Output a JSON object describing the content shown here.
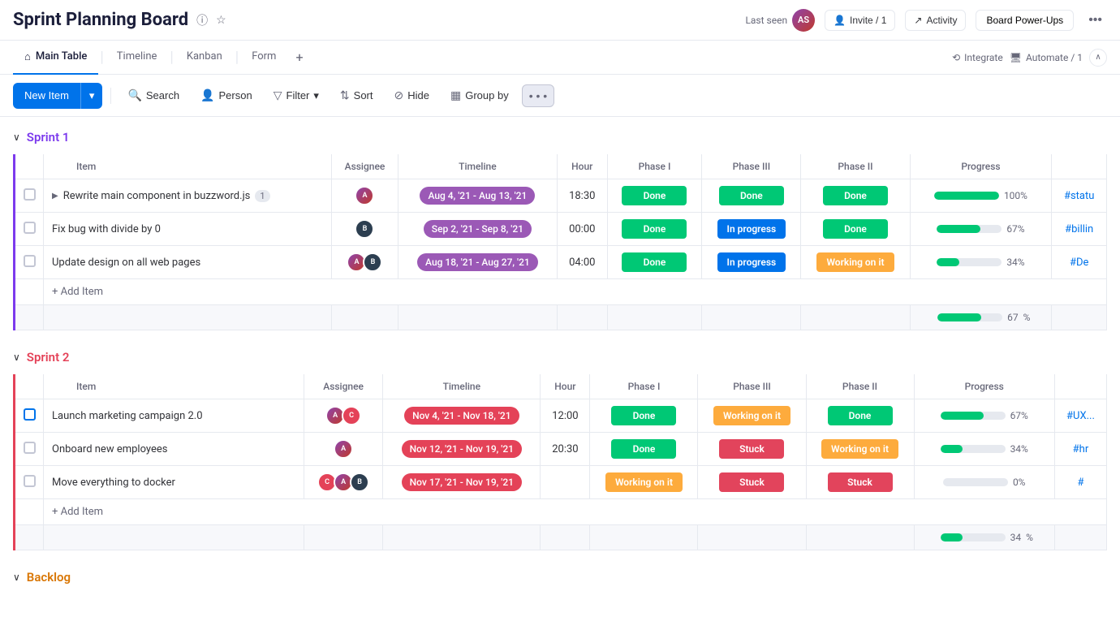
{
  "header": {
    "title": "Sprint Planning Board",
    "info_icon": "ⓘ",
    "star_icon": "☆",
    "last_seen_label": "Last seen",
    "invite_label": "Invite / 1",
    "activity_label": "Activity",
    "power_ups_label": "Board Power-Ups",
    "more_icon": "•••"
  },
  "nav": {
    "tabs": [
      {
        "label": "Main Table",
        "icon": "⌂",
        "active": true
      },
      {
        "label": "Timeline",
        "active": false
      },
      {
        "label": "Kanban",
        "active": false
      },
      {
        "label": "Form",
        "active": false
      }
    ],
    "integrate_label": "Integrate",
    "automate_label": "Automate / 1"
  },
  "toolbar": {
    "new_item_label": "New Item",
    "search_label": "Search",
    "person_label": "Person",
    "filter_label": "Filter",
    "sort_label": "Sort",
    "hide_label": "Hide",
    "group_by_label": "Group by"
  },
  "sprint1": {
    "title": "Sprint 1",
    "color": "purple",
    "columns": [
      "Item",
      "Assignee",
      "Timeline",
      "Hour",
      "Phase I",
      "Phase III",
      "Phase II",
      "Progress"
    ],
    "rows": [
      {
        "name": "Rewrite main component in buzzword.js",
        "badge": "1",
        "assignees": [
          "#8e44ad"
        ],
        "timeline": "Aug 4, '21 - Aug 13, '21",
        "timeline_color": "purple",
        "hour": "18:30",
        "phase1": "Done",
        "phase3": "Done",
        "phase2": "Done",
        "progress": 100,
        "tag": "#statu",
        "has_expand": true
      },
      {
        "name": "Fix bug with divide by 0",
        "badge": "",
        "assignees": [
          "#2c3e50"
        ],
        "timeline": "Sep 2, '21 - Sep 8, '21",
        "timeline_color": "purple",
        "hour": "00:00",
        "phase1": "Done",
        "phase3": "In progress",
        "phase2": "Done",
        "progress": 67,
        "tag": "#billin",
        "has_expand": false
      },
      {
        "name": "Update design on all web pages",
        "badge": "",
        "assignees": [
          "#8e44ad",
          "#2c3e50"
        ],
        "timeline": "Aug 18, '21 - Aug 27, '21",
        "timeline_color": "purple",
        "hour": "04:00",
        "phase1": "Done",
        "phase3": "In progress",
        "phase2": "Working on it",
        "progress": 34,
        "tag": "#De",
        "has_expand": false
      }
    ],
    "add_item_label": "+ Add Item",
    "summary_progress": 67
  },
  "sprint2": {
    "title": "Sprint 2",
    "color": "coral",
    "columns": [
      "Item",
      "Assignee",
      "Timeline",
      "Hour",
      "Phase I",
      "Phase III",
      "Phase II",
      "Progress"
    ],
    "rows": [
      {
        "name": "Launch marketing campaign 2.0",
        "badge": "",
        "assignees": [
          "#8e44ad",
          "#e44258"
        ],
        "timeline": "Nov 4, '21 - Nov 18, '21",
        "timeline_color": "coral",
        "hour": "12:00",
        "phase1": "Done",
        "phase3": "Working on it",
        "phase2": "Done",
        "progress": 67,
        "tag": "#UX...",
        "has_expand": false,
        "checked_blue": true
      },
      {
        "name": "Onboard new employees",
        "badge": "",
        "assignees": [
          "#8e44ad"
        ],
        "timeline": "Nov 12, '21 - Nov 19, '21",
        "timeline_color": "coral",
        "hour": "20:30",
        "phase1": "Done",
        "phase3": "Stuck",
        "phase2": "Working on it",
        "progress": 34,
        "tag": "#hr",
        "has_expand": false
      },
      {
        "name": "Move everything to docker",
        "badge": "",
        "assignees": [
          "#e44258",
          "#8e44ad",
          "#2c3e50"
        ],
        "timeline": "Nov 17, '21 - Nov 19, '21",
        "timeline_color": "coral",
        "hour": "",
        "phase1": "Working on it",
        "phase3": "Stuck",
        "phase2": "Stuck",
        "progress": 0,
        "tag": "#",
        "has_expand": false
      }
    ],
    "add_item_label": "+ Add Item",
    "summary_progress": 34
  },
  "backlog": {
    "title": "Backlog",
    "color": "orange"
  },
  "colors": {
    "done": "#00c875",
    "in_progress": "#0073ea",
    "working_on_it": "#fdab3d",
    "stuck": "#e2445c",
    "purple_accent": "#7c3aed",
    "coral_accent": "#e44258",
    "orange_accent": "#d97706"
  }
}
